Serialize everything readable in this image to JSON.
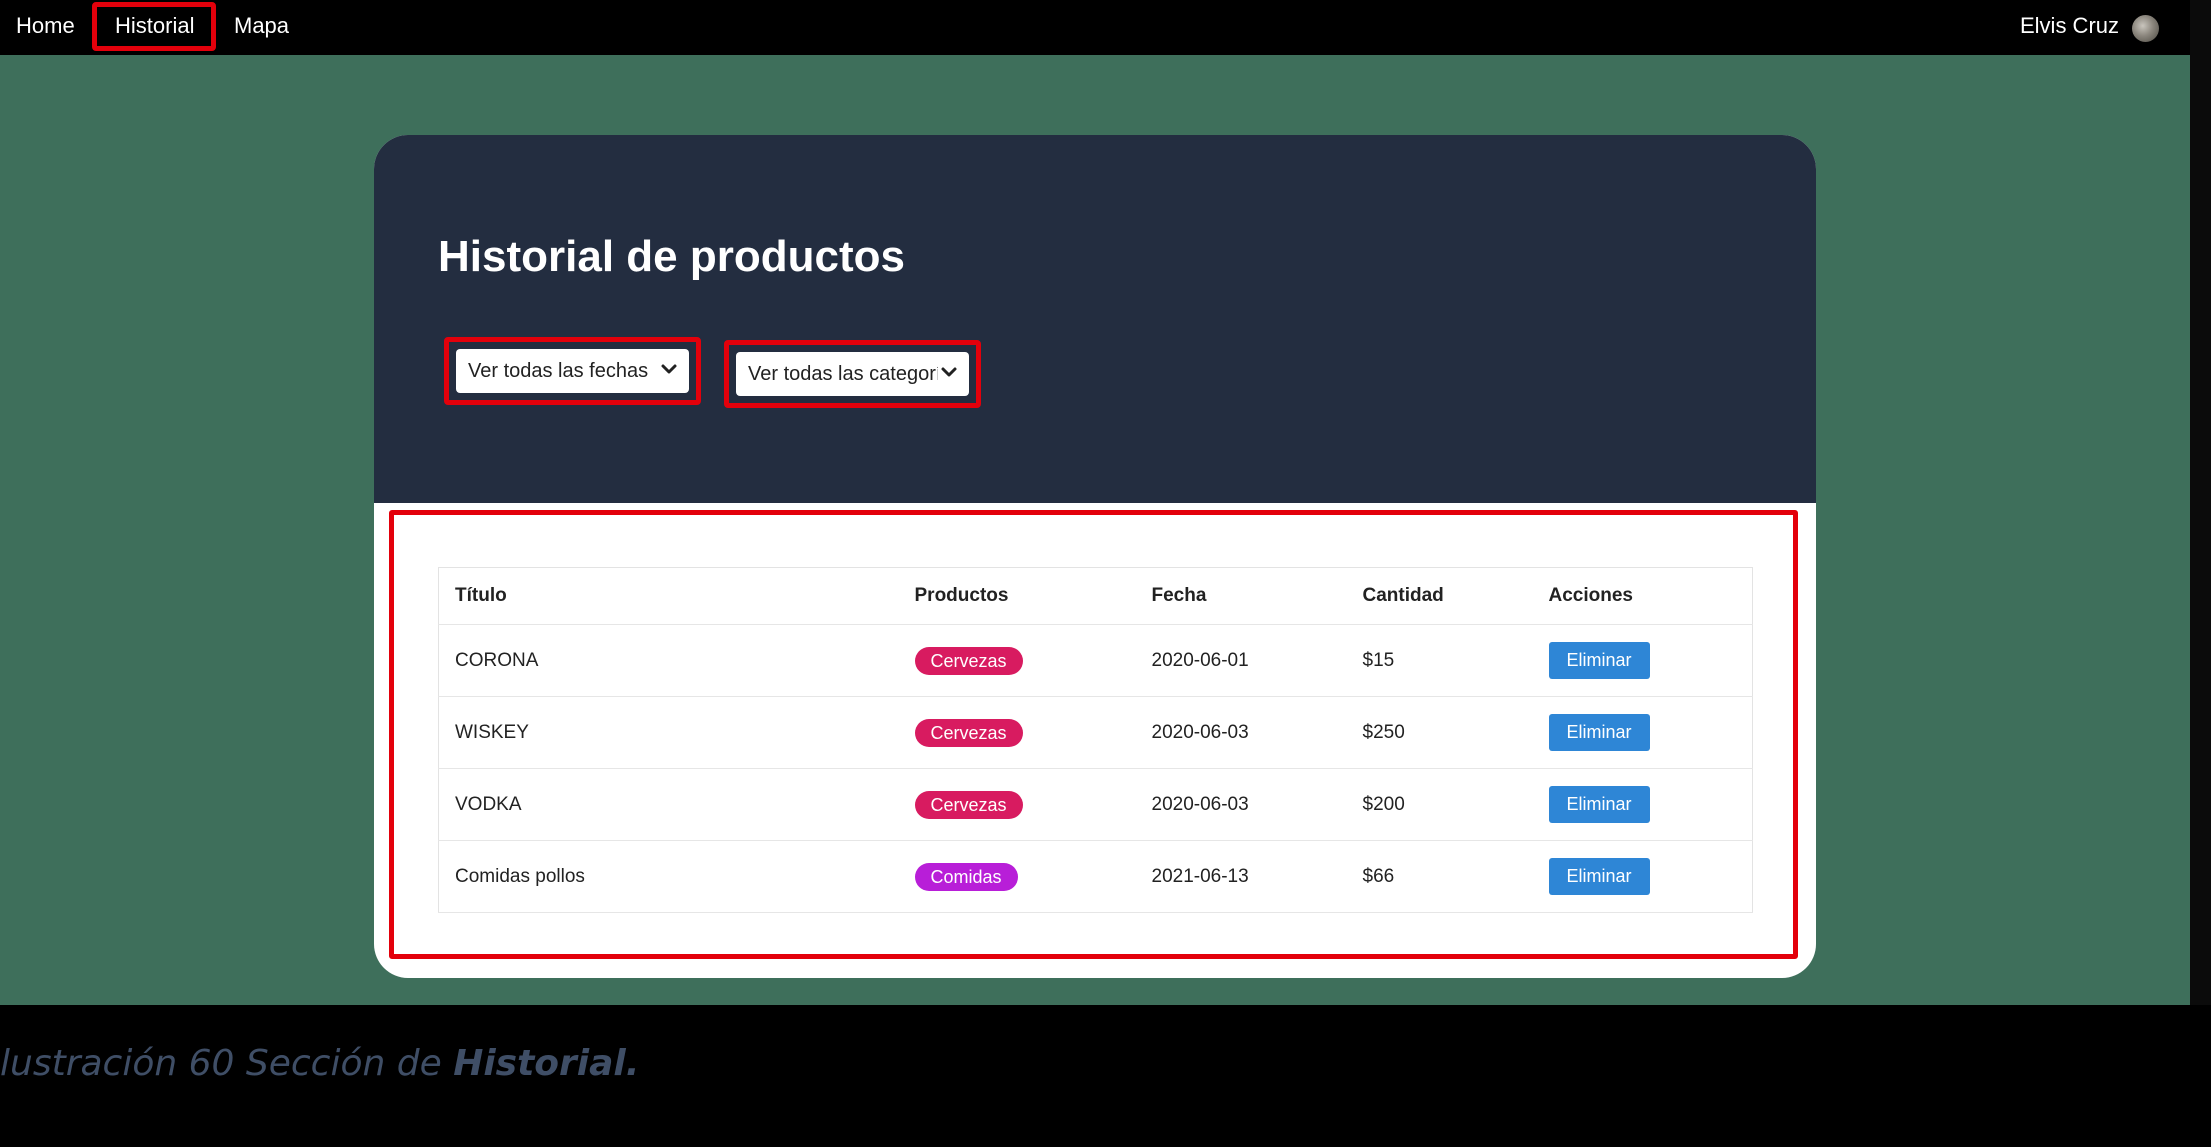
{
  "nav": {
    "links": [
      "Home",
      "Historial",
      "Mapa"
    ],
    "user_name": "Elvis Cruz"
  },
  "page": {
    "title": "Historial de productos",
    "filters": {
      "dates_selected": "Ver todas las fechas",
      "categories_selected": "Ver todas las categorías"
    }
  },
  "table": {
    "headers": [
      "Título",
      "Productos",
      "Fecha",
      "Cantidad",
      "Acciones"
    ],
    "rows": [
      {
        "titulo": "CORONA",
        "producto": "Cervezas",
        "fecha": "2020-06-01",
        "cantidad": "$15",
        "accion": "Eliminar"
      },
      {
        "titulo": "WISKEY",
        "producto": "Cervezas",
        "fecha": "2020-06-03",
        "cantidad": "$250",
        "accion": "Eliminar"
      },
      {
        "titulo": "VODKA",
        "producto": "Cervezas",
        "fecha": "2020-06-03",
        "cantidad": "$200",
        "accion": "Eliminar"
      },
      {
        "titulo": "Comidas pollos",
        "producto": "Comidas",
        "fecha": "2021-06-13",
        "cantidad": "$66",
        "accion": "Eliminar"
      }
    ]
  },
  "caption": {
    "prefix": "lustración 60 Sección de ",
    "emphasis": "Historial",
    "suffix": "."
  },
  "colors": {
    "background_green": "#3e6f5b",
    "header_navy": "#232d40",
    "highlight_red": "#e3000b",
    "badge_cervezas": "#d81b60",
    "badge_comidas": "#b81ed8",
    "button_blue": "#2e86d6"
  }
}
